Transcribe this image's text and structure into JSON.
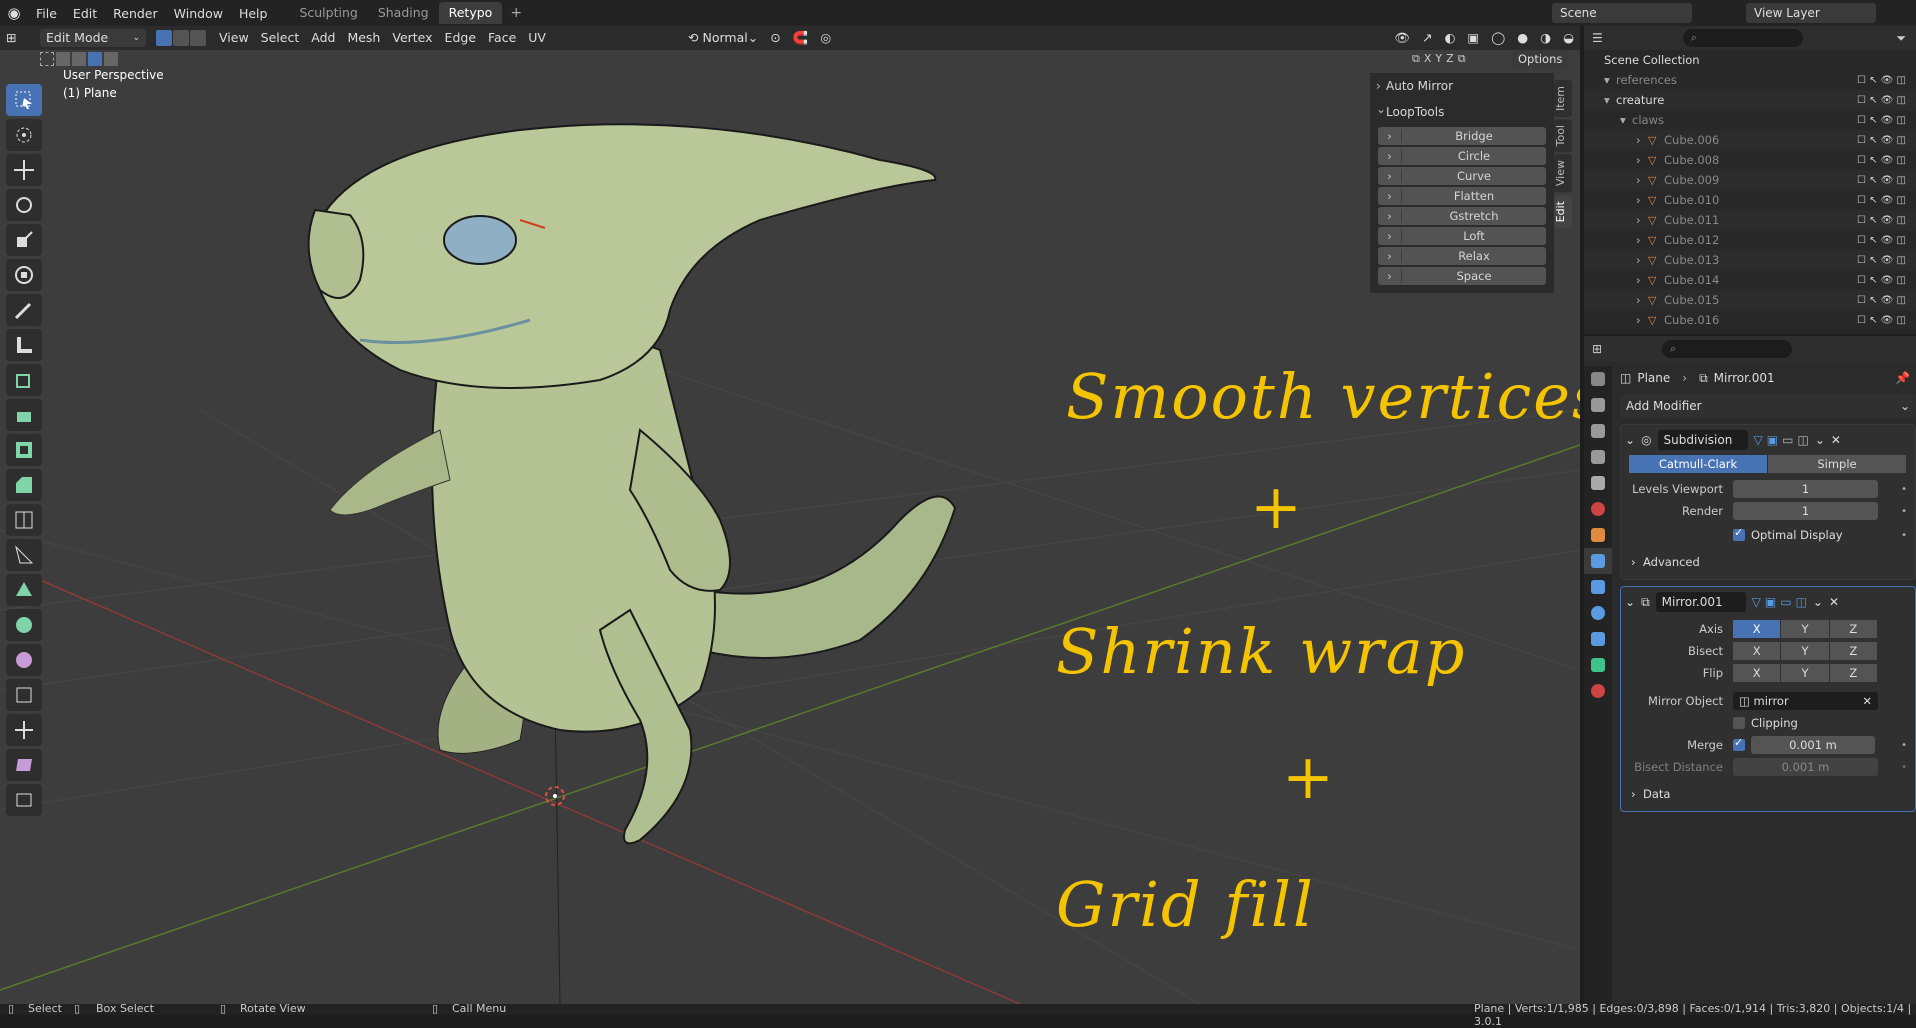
{
  "topbar": {
    "menus": [
      "File",
      "Edit",
      "Render",
      "Window",
      "Help"
    ],
    "workspaces": [
      "Sculpting",
      "Shading",
      "Retypo"
    ],
    "active_workspace": "Retypo",
    "scene": "Scene",
    "view_layer": "View Layer"
  },
  "header": {
    "mode": "Edit Mode",
    "menus": [
      "View",
      "Select",
      "Add",
      "Mesh",
      "Vertex",
      "Edge",
      "Face",
      "UV"
    ],
    "orientation": "Normal",
    "axes": [
      "X",
      "Y",
      "Z"
    ],
    "options": "Options"
  },
  "viewport": {
    "perspective": "User Perspective",
    "object": "(1) Plane"
  },
  "npanel": {
    "auto_mirror": "Auto Mirror",
    "looptools": "LoopTools",
    "buttons": [
      "Bridge",
      "Circle",
      "Curve",
      "Flatten",
      "Gstretch",
      "Loft",
      "Relax",
      "Space"
    ],
    "tabs": [
      "Item",
      "Tool",
      "View",
      "Edit"
    ]
  },
  "annotations": [
    "Smooth vertices",
    "+",
    "Shrink wrap",
    "+",
    "Grid fill"
  ],
  "outliner": {
    "root": "Scene Collection",
    "rows": [
      {
        "name": "references",
        "indent": 1,
        "dim": true
      },
      {
        "name": "creature",
        "indent": 1,
        "dim": false
      },
      {
        "name": "claws",
        "indent": 2,
        "dim": true
      },
      {
        "name": "Cube.006",
        "indent": 3,
        "dim": true
      },
      {
        "name": "Cube.008",
        "indent": 3,
        "dim": true
      },
      {
        "name": "Cube.009",
        "indent": 3,
        "dim": true
      },
      {
        "name": "Cube.010",
        "indent": 3,
        "dim": true
      },
      {
        "name": "Cube.011",
        "indent": 3,
        "dim": true
      },
      {
        "name": "Cube.012",
        "indent": 3,
        "dim": true
      },
      {
        "name": "Cube.013",
        "indent": 3,
        "dim": true
      },
      {
        "name": "Cube.014",
        "indent": 3,
        "dim": true
      },
      {
        "name": "Cube.015",
        "indent": 3,
        "dim": true
      },
      {
        "name": "Cube.016",
        "indent": 3,
        "dim": true
      }
    ]
  },
  "properties": {
    "object": "Plane",
    "modifier": "Mirror.001",
    "add_modifier": "Add Modifier",
    "subdivision": {
      "name": "Subdivision",
      "types": [
        "Catmull-Clark",
        "Simple"
      ],
      "levels_viewport_label": "Levels Viewport",
      "levels_viewport": "1",
      "render_label": "Render",
      "render": "1",
      "optimal_display": "Optimal Display",
      "advanced": "Advanced"
    },
    "mirror": {
      "name": "Mirror.001",
      "axis_label": "Axis",
      "bisect_label": "Bisect",
      "flip_label": "Flip",
      "xyz": [
        "X",
        "Y",
        "Z"
      ],
      "mirror_object_label": "Mirror Object",
      "mirror_object": "mirror",
      "clipping": "Clipping",
      "merge_label": "Merge",
      "merge": "0.001 m",
      "bisect_distance_label": "Bisect Distance",
      "bisect_distance": "0.001 m",
      "data": "Data"
    }
  },
  "status": {
    "select": "Select",
    "box_select": "Box Select",
    "rotate": "Rotate View",
    "call_menu": "Call Menu",
    "stats": "Plane | Verts:1/1,985 | Edges:0/3,898 | Faces:0/1,914 | Tris:3,820 | Objects:1/4 | 3.0.1"
  }
}
